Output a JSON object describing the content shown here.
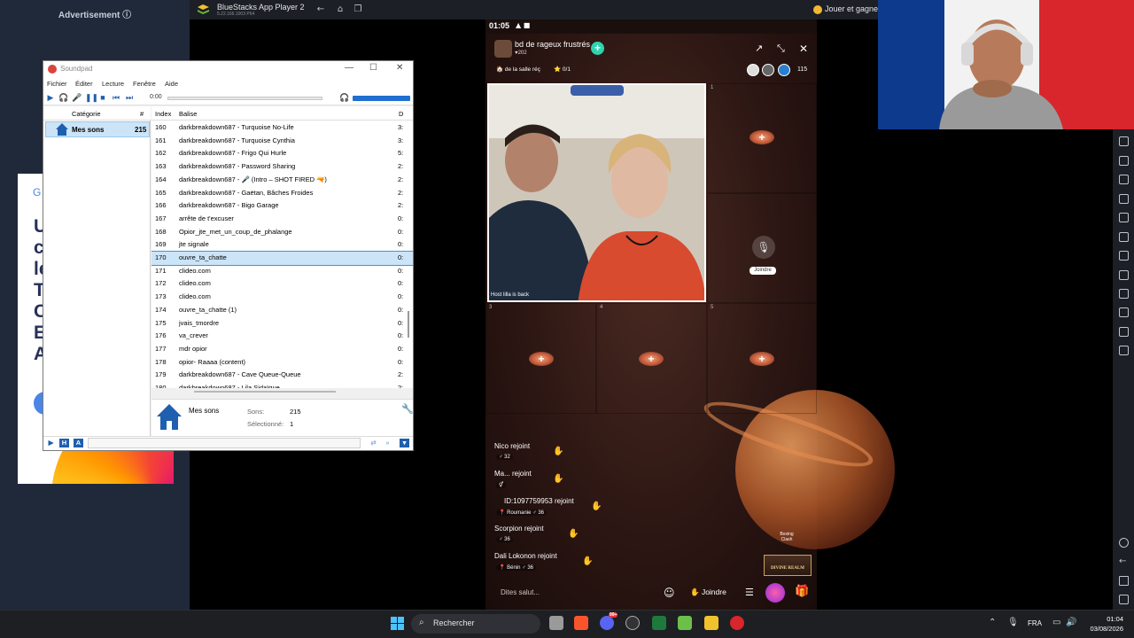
{
  "advertisement": {
    "label": "Advertisement ⓘ",
    "letters": "U\nc\nle\nT\nC\nE\nA",
    "brand_letter": "G"
  },
  "bluestacks": {
    "title": "BlueStacks App Player 2",
    "version": "5.22.166.1003 P64",
    "play_label": "Jouer et gagner"
  },
  "phone": {
    "status_time": "01:05",
    "room": {
      "name": "bd de rageux frustrés",
      "sub": "♥202",
      "add": "+"
    },
    "tags": {
      "salle": "🏠 de la salle réç",
      "star": "⭐ 0/1"
    },
    "viewer_count": "115",
    "seats": [
      {
        "num": "1"
      },
      {
        "num": "3"
      },
      {
        "num": "4"
      },
      {
        "num": "5"
      }
    ],
    "host_label": "Host  lilla is back",
    "joindre_seat": "Joindre",
    "chat": [
      {
        "name": "Nico",
        "action": "rejoint",
        "badge": "♂ 32"
      },
      {
        "name": "Ma...",
        "action": "rejoint",
        "badge": "⚥"
      },
      {
        "name": "ID:1097759953",
        "action": "rejoint",
        "badge": "📍 Roumanie  ♂ 36"
      },
      {
        "name": "Scorpion",
        "action": "rejoint",
        "badge": "♂ 36"
      },
      {
        "name": "Dali Lokonon",
        "action": "rejoint",
        "badge": "📍 Bénin  ♂ 36"
      }
    ],
    "boxing": "Boxing Clash",
    "divine": "DIVINE REALM",
    "input_placeholder": "Dites salut...",
    "joindre_btn": "✋ Joindre"
  },
  "soundpad": {
    "title": "Soundpad",
    "menu": [
      "Fichier",
      "Éditer",
      "Lecture",
      "Fenêtre",
      "Aide"
    ],
    "time": "0:00",
    "category_header": "Catégorie",
    "count_header": "#",
    "category": {
      "name": "Mes sons",
      "count": "215"
    },
    "list_headers": {
      "index": "Index",
      "tag": "Balise",
      "dur": "D"
    },
    "rows": [
      {
        "idx": "160",
        "tag": "darkbreakdown687 - Turquoise No-Life",
        "dur": "3:"
      },
      {
        "idx": "161",
        "tag": "darkbreakdown687 - Turquoise Cynthia",
        "dur": "3:"
      },
      {
        "idx": "162",
        "tag": "darkbreakdown687 - Frigo Qui Hurle",
        "dur": "5:"
      },
      {
        "idx": "163",
        "tag": "darkbreakdown687 - Password Sharing",
        "dur": "2:"
      },
      {
        "idx": "164",
        "tag": "darkbreakdown687 - 🎤 (Intro – SHOT FIRED 🔫)",
        "dur": "2:"
      },
      {
        "idx": "165",
        "tag": "darkbreakdown687 - Gaëtan, Bâches Froides",
        "dur": "2:"
      },
      {
        "idx": "166",
        "tag": "darkbreakdown687 - Bigo Garage",
        "dur": "2:"
      },
      {
        "idx": "167",
        "tag": "arrête de t'excuser",
        "dur": "0:"
      },
      {
        "idx": "168",
        "tag": "Opior_jte_met_un_coup_de_phalange",
        "dur": "0:"
      },
      {
        "idx": "169",
        "tag": "jte signale",
        "dur": "0:"
      },
      {
        "idx": "170",
        "tag": "ouvre_ta_chatte",
        "dur": "0:",
        "selected": true
      },
      {
        "idx": "171",
        "tag": "clideo.com",
        "dur": "0:"
      },
      {
        "idx": "172",
        "tag": "clideo.com",
        "dur": "0:"
      },
      {
        "idx": "173",
        "tag": "clideo.com",
        "dur": "0:"
      },
      {
        "idx": "174",
        "tag": "ouvre_ta_chatte (1)",
        "dur": "0:"
      },
      {
        "idx": "175",
        "tag": "jvais_tmordre",
        "dur": "0:"
      },
      {
        "idx": "176",
        "tag": "va_crever",
        "dur": "0:"
      },
      {
        "idx": "177",
        "tag": "mdr opior",
        "dur": "0:"
      },
      {
        "idx": "178",
        "tag": "opior- Raaaa (content)",
        "dur": "0:"
      },
      {
        "idx": "179",
        "tag": "darkbreakdown687 - Cave Queue-Queue",
        "dur": "2:"
      },
      {
        "idx": "180",
        "tag": "darkbreakdown687 - Lila Sidaïque",
        "dur": "2:"
      }
    ],
    "info": {
      "name": "Mes sons",
      "sons_label": "Sons:",
      "sons_value": "215",
      "sel_label": "Sélectionné:",
      "sel_value": "1"
    }
  },
  "taskbar": {
    "search": "Rechercher",
    "lang": "FRA",
    "time": "01:04",
    "date": "03/08/2026",
    "discord_badge": "99+"
  },
  "colors": {
    "accent": "#1f5fb0",
    "selection": "#cce4f7",
    "teal": "#2fd3b0"
  }
}
